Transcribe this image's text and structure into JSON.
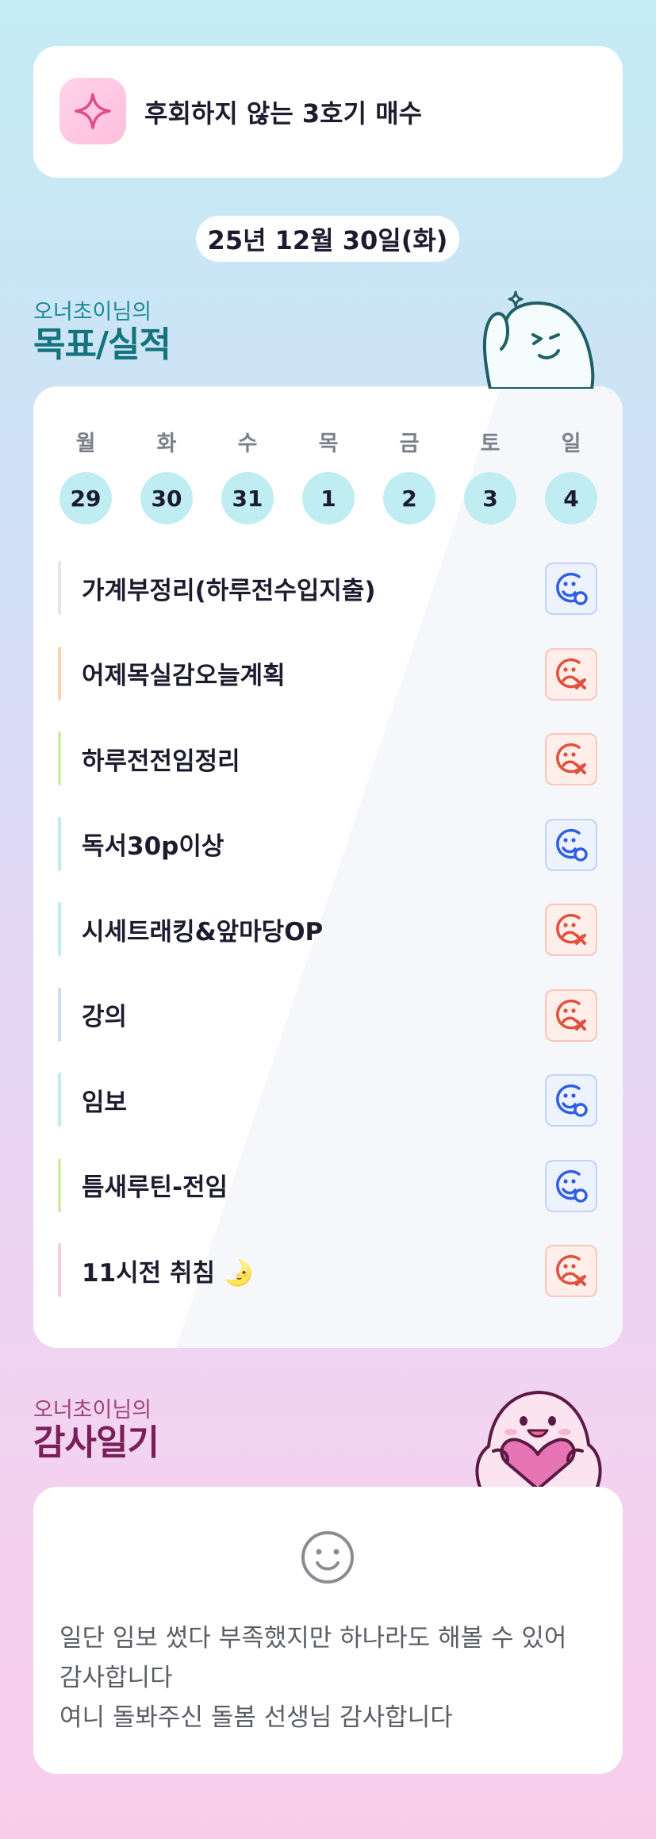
{
  "colors": {
    "accent_teal": "#15737e",
    "accent_plum": "#7a1f58",
    "done_blue": "#2f5fe0",
    "miss_red": "#e0503c",
    "day_circle": "#bfedf2"
  },
  "top_goal": {
    "icon": "sparkle-icon",
    "text": "후회하지 않는 3호기 매수"
  },
  "date": "25년 12월 30일(화)",
  "goals_section": {
    "owner": "오너초이님의",
    "title": "목표/실적"
  },
  "week": {
    "days": [
      {
        "label": "월",
        "date": "29"
      },
      {
        "label": "화",
        "date": "30"
      },
      {
        "label": "수",
        "date": "31"
      },
      {
        "label": "목",
        "date": "1"
      },
      {
        "label": "금",
        "date": "2"
      },
      {
        "label": "토",
        "date": "3"
      },
      {
        "label": "일",
        "date": "4"
      }
    ]
  },
  "goals": [
    {
      "label": "가계부정리(하루전수입지출)",
      "status": "done",
      "bar_color": "#e4e4ea"
    },
    {
      "label": "어제목실감오늘계획",
      "status": "miss",
      "bar_color": "#fcd5b0"
    },
    {
      "label": "하루전전임정리",
      "status": "miss",
      "bar_color": "#d5ecae"
    },
    {
      "label": "독서30p이상",
      "status": "done",
      "bar_color": "#bfecee"
    },
    {
      "label": "시세트래킹&앞마당OP",
      "status": "miss",
      "bar_color": "#bfecee"
    },
    {
      "label": "강의",
      "status": "miss",
      "bar_color": "#cfdcf8"
    },
    {
      "label": "임보",
      "status": "done",
      "bar_color": "#bfecee"
    },
    {
      "label": "틈새루틴-전임",
      "status": "done",
      "bar_color": "#d5ecae"
    },
    {
      "label": "11시전 취침 🌛",
      "status": "miss",
      "bar_color": "#f9cde0"
    }
  ],
  "thanks_section": {
    "owner": "오너초이님의",
    "title": "감사일기",
    "icon": "smile-face-icon",
    "lines": [
      "일단 임보 썼다 부족했지만 하나라도 해볼 수 있어",
      "감사합니다",
      "여니 돌봐주신 돌봄 선생님 감사합니다"
    ]
  }
}
